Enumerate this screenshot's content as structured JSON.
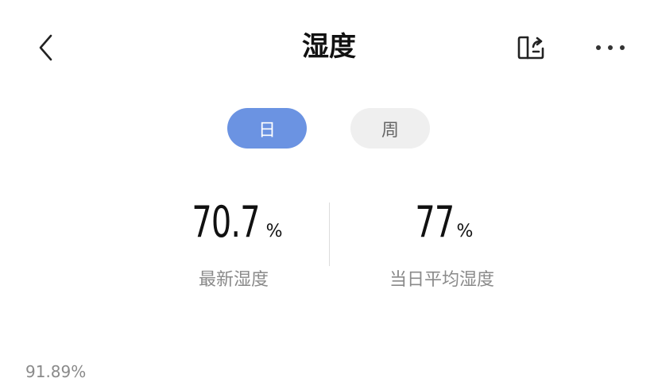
{
  "header": {
    "title": "湿度",
    "back_icon": "chevron-left-icon",
    "share_icon": "share-icon",
    "more_icon": "more-icon"
  },
  "tabs": [
    {
      "label": "日",
      "active": true
    },
    {
      "label": "周",
      "active": false
    }
  ],
  "stats": {
    "latest": {
      "value": "70.7",
      "unit": "%",
      "label": "最新湿度"
    },
    "daily_average": {
      "value": "77",
      "unit": "%",
      "label": "当日平均湿度"
    }
  },
  "chart": {
    "y_max_label": "91.89%"
  },
  "colors": {
    "accent": "#6b93e2",
    "tab_inactive_bg": "#efefef",
    "label_gray": "#8a8a8a"
  }
}
